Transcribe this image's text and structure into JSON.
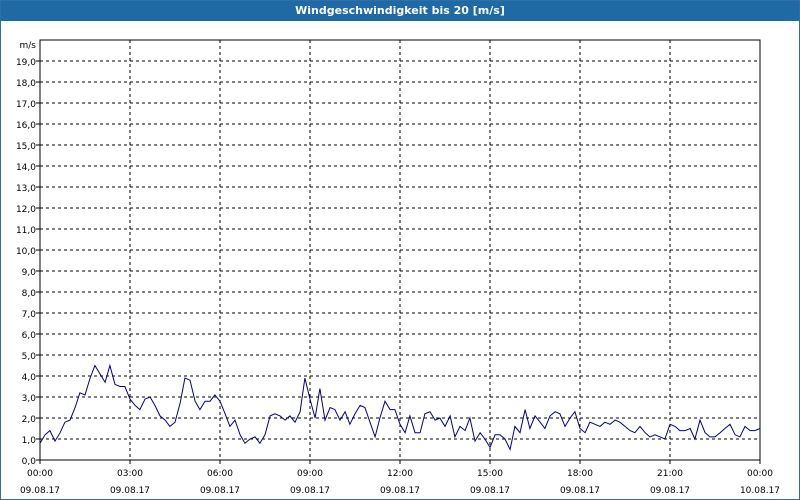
{
  "window": {
    "title": "Windgeschwindigkeit bis 20 [m/s]"
  },
  "chart_data": {
    "type": "line",
    "title": "Windgeschwindigkeit bis 20 [m/s]",
    "ylabel": "m/s",
    "xlabel": "",
    "ylim": [
      0,
      20
    ],
    "xlim_hours": [
      0,
      24
    ],
    "grid": true,
    "y_tick_labels": [
      "0,0",
      "1,0",
      "2,0",
      "3,0",
      "4,0",
      "5,0",
      "6,0",
      "7,0",
      "8,0",
      "9,0",
      "10,0",
      "11,0",
      "12,0",
      "13,0",
      "14,0",
      "15,0",
      "16,0",
      "17,0",
      "18,0",
      "19,0"
    ],
    "y_tick_values": [
      0,
      1,
      2,
      3,
      4,
      5,
      6,
      7,
      8,
      9,
      10,
      11,
      12,
      13,
      14,
      15,
      16,
      17,
      18,
      19
    ],
    "x_ticks": [
      {
        "hour": 0,
        "time": "00:00",
        "date": "09.08.17"
      },
      {
        "hour": 3,
        "time": "03:00",
        "date": "09.08.17"
      },
      {
        "hour": 6,
        "time": "06:00",
        "date": "09.08.17"
      },
      {
        "hour": 9,
        "time": "09:00",
        "date": "09.08.17"
      },
      {
        "hour": 12,
        "time": "12:00",
        "date": "09.08.17"
      },
      {
        "hour": 15,
        "time": "15:00",
        "date": "09.08.17"
      },
      {
        "hour": 18,
        "time": "18:00",
        "date": "09.08.17"
      },
      {
        "hour": 21,
        "time": "21:00",
        "date": "09.08.17"
      },
      {
        "hour": 24,
        "time": "00:00",
        "date": "10.08.17"
      }
    ],
    "series": [
      {
        "color": "#00008b",
        "x_hours": [
          0,
          0.17,
          0.33,
          0.5,
          0.67,
          0.83,
          1.0,
          1.17,
          1.33,
          1.5,
          1.67,
          1.83,
          2.0,
          2.17,
          2.33,
          2.5,
          2.67,
          2.83,
          3.0,
          3.17,
          3.33,
          3.5,
          3.67,
          3.83,
          4.0,
          4.17,
          4.33,
          4.5,
          4.67,
          4.83,
          5.0,
          5.17,
          5.33,
          5.5,
          5.67,
          5.83,
          6.0,
          6.17,
          6.33,
          6.5,
          6.67,
          6.83,
          7.0,
          7.17,
          7.33,
          7.5,
          7.67,
          7.83,
          8.0,
          8.17,
          8.33,
          8.5,
          8.67,
          8.83,
          9.0,
          9.17,
          9.33,
          9.5,
          9.67,
          9.83,
          10.0,
          10.17,
          10.33,
          10.5,
          10.67,
          10.83,
          11.0,
          11.17,
          11.33,
          11.5,
          11.67,
          11.83,
          12.0,
          12.17,
          12.33,
          12.5,
          12.67,
          12.83,
          13.0,
          13.17,
          13.33,
          13.5,
          13.67,
          13.83,
          14.0,
          14.17,
          14.33,
          14.5,
          14.67,
          14.83,
          15.0,
          15.17,
          15.33,
          15.5,
          15.67,
          15.83,
          16.0,
          16.17,
          16.33,
          16.5,
          16.67,
          16.83,
          17.0,
          17.17,
          17.33,
          17.5,
          17.67,
          17.83,
          18.0,
          18.17,
          18.33,
          18.5,
          18.67,
          18.83,
          19.0,
          19.17,
          19.33,
          19.5,
          19.67,
          19.83,
          20.0,
          20.17,
          20.33,
          20.5,
          20.67,
          20.83,
          21.0,
          21.17,
          21.33,
          21.5,
          21.67,
          21.83,
          22.0,
          22.17,
          22.33,
          22.5,
          22.67,
          22.83,
          23.0,
          23.17,
          23.33,
          23.5,
          23.67,
          23.83,
          24.0
        ],
        "values": [
          0.8,
          1.2,
          1.4,
          0.9,
          1.3,
          1.8,
          1.9,
          2.5,
          3.2,
          3.1,
          3.9,
          4.5,
          4.1,
          3.7,
          4.5,
          3.6,
          3.5,
          3.5,
          2.9,
          2.6,
          2.4,
          2.9,
          3.0,
          2.6,
          2.1,
          1.9,
          1.6,
          1.8,
          2.7,
          3.9,
          3.8,
          2.8,
          2.4,
          2.8,
          2.8,
          3.1,
          2.8,
          2.2,
          1.6,
          1.9,
          1.2,
          0.8,
          1.0,
          1.1,
          0.8,
          1.2,
          2.1,
          2.2,
          2.1,
          1.9,
          2.1,
          1.8,
          2.3,
          3.9,
          2.9,
          2.0,
          3.4,
          1.9,
          2.5,
          2.4,
          1.9,
          2.3,
          1.7,
          2.2,
          2.6,
          2.5,
          1.8,
          1.1,
          2.0,
          2.8,
          2.4,
          2.4,
          1.7,
          1.3,
          2.1,
          1.3,
          1.3,
          2.2,
          2.3,
          1.9,
          2.0,
          1.6,
          2.1,
          1.1,
          1.6,
          1.4,
          2.0,
          0.9,
          1.3,
          1.0,
          0.6,
          1.2,
          1.2,
          1.0,
          0.5,
          1.6,
          1.3,
          2.4,
          1.5,
          2.1,
          1.8,
          1.5,
          2.1,
          2.3,
          2.2,
          1.6,
          2.0,
          2.3,
          1.5,
          1.3,
          1.8,
          1.7,
          1.6,
          1.8,
          1.7,
          1.9,
          1.8,
          1.6,
          1.4,
          1.3,
          1.6,
          1.3,
          1.1,
          1.2,
          1.1,
          1.0,
          1.7,
          1.6,
          1.4,
          1.4,
          1.5,
          1.0,
          1.9,
          1.3,
          1.1,
          1.1,
          1.3,
          1.5,
          1.7,
          1.2,
          1.1,
          1.6,
          1.4,
          1.4,
          1.5
        ]
      }
    ]
  }
}
